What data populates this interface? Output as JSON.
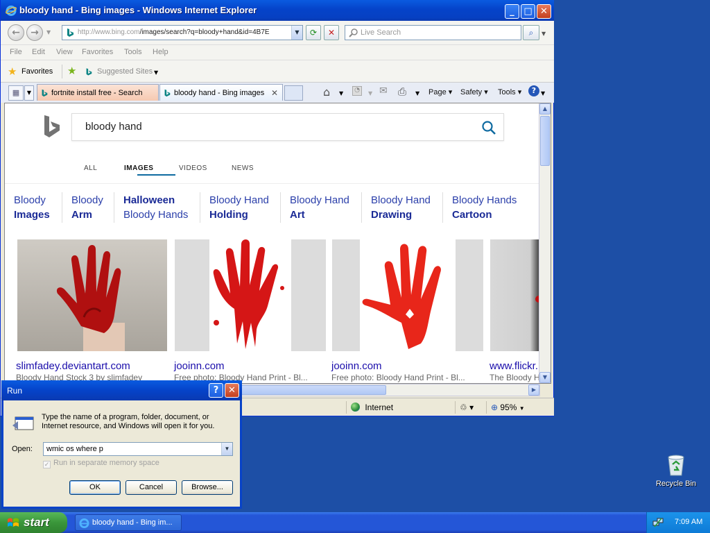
{
  "ie": {
    "title": "bloody hand - Bing images - Windows Internet Explorer",
    "address_domain": "http://www.bing.com",
    "address_path": "/images/search?q=bloody+hand&id=4B7E",
    "live_search_placeholder": "Live Search",
    "menu": [
      "File",
      "Edit",
      "View",
      "Favorites",
      "Tools",
      "Help"
    ],
    "favorites_label": "Favorites",
    "suggested_sites": "Suggested Sites",
    "tabs": [
      {
        "label": "fortnite install free - Search"
      },
      {
        "label": "bloody hand - Bing images"
      }
    ],
    "commands": {
      "page": "Page",
      "safety": "Safety",
      "tools": "Tools"
    },
    "status": {
      "zone": "Internet",
      "zoom": "95%"
    }
  },
  "bing": {
    "query": "bloody hand",
    "scopes": [
      "ALL",
      "IMAGES",
      "VIDEOS",
      "NEWS"
    ],
    "related": [
      {
        "line1": "Bloody",
        "line2": "Images"
      },
      {
        "line1": "Bloody",
        "line2": "Arm"
      },
      {
        "line1": "Halloween",
        "line2": "Bloody Hands"
      },
      {
        "line1": "Bloody Hand",
        "line2": "Holding"
      },
      {
        "line1": "Bloody Hand",
        "line2": "Art"
      },
      {
        "line1": "Bloody Hand",
        "line2": "Drawing"
      },
      {
        "line1": "Bloody Hands",
        "line2": "Cartoon"
      }
    ],
    "results": [
      {
        "source": "slimfadey.deviantart.com",
        "caption": "Bloody Hand Stock 3 by slimfadey"
      },
      {
        "source": "jooinn.com",
        "caption": "Free photo: Bloody Hand Print - Bl..."
      },
      {
        "source": "jooinn.com",
        "caption": "Free photo: Bloody Hand Print - Bl..."
      },
      {
        "source": "www.flickr.",
        "caption": "The Bloody H"
      }
    ]
  },
  "run": {
    "title": "Run",
    "message": "Type the name of a program, folder, document, or Internet resource, and Windows will open it for you.",
    "open_label": "Open:",
    "open_value": "wmic os where p",
    "checkbox_label": "Run in separate memory space",
    "ok": "OK",
    "cancel": "Cancel",
    "browse": "Browse..."
  },
  "taskbar": {
    "start": "start",
    "task": "bloody hand - Bing im...",
    "time": "7:09 AM"
  },
  "desktop": {
    "recycle_bin": "Recycle Bin"
  }
}
